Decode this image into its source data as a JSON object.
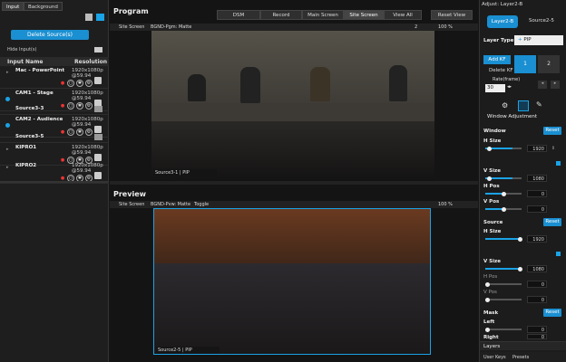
{
  "left_panel": {
    "tabs": [
      {
        "label": "Input"
      },
      {
        "label": "Background"
      }
    ],
    "delete_button": "Delete Source(s)",
    "hide_inputs": "Hide Input(s)",
    "col_name": "Input Name",
    "col_resolution": "Resolution",
    "sources": [
      {
        "name": "Mac - PowerPoint",
        "res": "1920x1080p @59.94"
      },
      {
        "name": "CAM1 - Stage",
        "res": "1920x1080p @59.94"
      },
      {
        "name": "Source3-3",
        "res": ""
      },
      {
        "name": "CAM2 - Audience",
        "res": "1920x1080p @59.94"
      },
      {
        "name": "Source3-5",
        "res": ""
      },
      {
        "name": "KIPRO1",
        "res": "1920x1080p @59.94"
      },
      {
        "name": "KIPRO2",
        "res": "1920x1080p @59.94"
      }
    ]
  },
  "program": {
    "title": "Program",
    "buttons": [
      "DSM",
      "Record",
      "Main Screen",
      "Site Screen",
      "View All"
    ],
    "reset_view": "Reset View",
    "site_screen": "Site Screen",
    "bgnd": "BGND-Pgm: Matte",
    "zoom": "100 %",
    "layer_num": "2",
    "caption": "Source3-1 | PIP"
  },
  "preview": {
    "title": "Preview",
    "site_screen": "Site Screen",
    "bgnd": "BGND-Pvw: Matte",
    "toggle": "Toggle",
    "zoom": "100 %",
    "caption": "Source2-5 | PIP"
  },
  "right_panel": {
    "header": "Adjust: Layer2-B",
    "layer_tabs": [
      "Layer2-B",
      "Source2-5"
    ],
    "layer_type_label": "Layer Type",
    "layer_type_value": "PIP",
    "add_kf": "Add KF",
    "delete_kf": "Delete KF",
    "rate_label": "Rate(frame)",
    "rate_value": "30",
    "kf_1": "1",
    "kf_2": "2",
    "window_adjustment": "Window Adjustment",
    "window": "Window",
    "reset": "Reset",
    "h_size": "H Size",
    "h_size_val": "1920",
    "v_size": "V Size",
    "v_size_val": "1080",
    "h_pos": "H Pos",
    "h_pos_val": "0",
    "v_pos": "V Pos",
    "v_pos_val": "0",
    "source": "Source",
    "s_h_size_val": "1920",
    "s_v_size_val": "1080",
    "s_h_pos_val": "0",
    "s_v_pos_val": "0",
    "mask": "Mask",
    "left": "Left",
    "left_val": "0",
    "right": "Right",
    "right_val": "0",
    "layers_tab": "Layers",
    "bottom_tabs": [
      "User Keys",
      "Presets"
    ]
  },
  "colors": {
    "accent": "#1aa3e6",
    "border_blue": "#1a8fd1"
  }
}
